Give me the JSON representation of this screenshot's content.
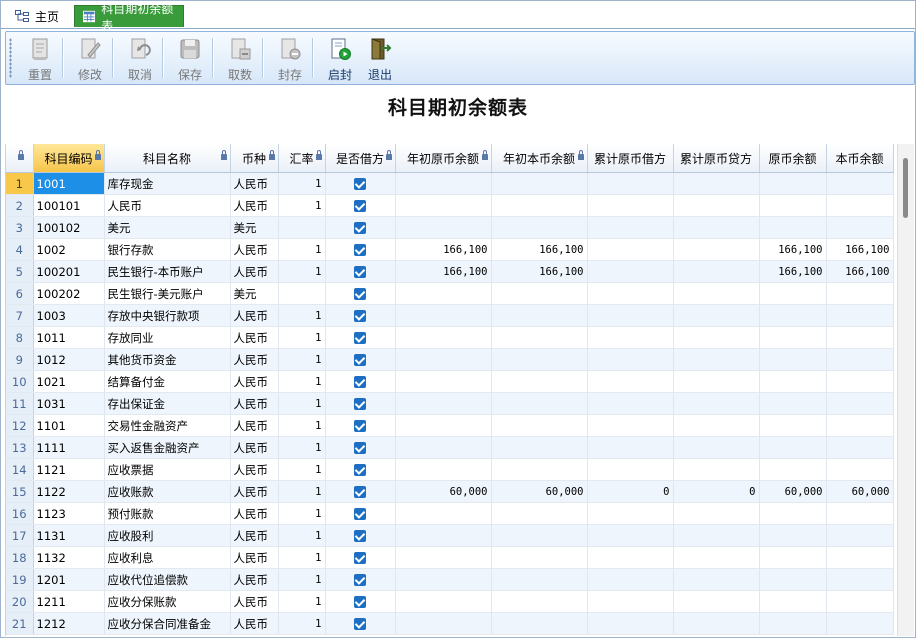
{
  "tabs": [
    {
      "label": "主页",
      "icon": "hierarchy-icon"
    },
    {
      "label": "科目期初余额表",
      "icon": "table-icon"
    }
  ],
  "toolbar": {
    "reset": "重置",
    "edit": "修改",
    "cancel": "取消",
    "save": "保存",
    "fetch": "取数",
    "seal": "封存",
    "unseal": "启封",
    "exit": "退出"
  },
  "title": "科目期初余额表",
  "columns": [
    "科目编码",
    "科目名称",
    "币种",
    "汇率",
    "是否借方",
    "年初原币余额",
    "年初本币余额",
    "累计原币借方",
    "累计原币贷方",
    "原币余额",
    "本币余额"
  ],
  "rows": [
    {
      "n": "1",
      "code": "1001",
      "name": "库存现金",
      "cur": "人民币",
      "rate": "1",
      "debit": true,
      "a": "",
      "b": "",
      "c": "",
      "d": "",
      "e": "",
      "f": ""
    },
    {
      "n": "2",
      "code": "100101",
      "name": "人民币",
      "cur": "人民币",
      "rate": "1",
      "debit": true,
      "a": "",
      "b": "",
      "c": "",
      "d": "",
      "e": "",
      "f": ""
    },
    {
      "n": "3",
      "code": "100102",
      "name": "美元",
      "cur": "美元",
      "rate": "",
      "debit": true,
      "a": "",
      "b": "",
      "c": "",
      "d": "",
      "e": "",
      "f": ""
    },
    {
      "n": "4",
      "code": "1002",
      "name": "银行存款",
      "cur": "人民币",
      "rate": "1",
      "debit": true,
      "a": "166,100",
      "b": "166,100",
      "c": "",
      "d": "",
      "e": "166,100",
      "f": "166,100"
    },
    {
      "n": "5",
      "code": "100201",
      "name": "民生银行-本币账户",
      "cur": "人民币",
      "rate": "1",
      "debit": true,
      "a": "166,100",
      "b": "166,100",
      "c": "",
      "d": "",
      "e": "166,100",
      "f": "166,100"
    },
    {
      "n": "6",
      "code": "100202",
      "name": "民生银行-美元账户",
      "cur": "美元",
      "rate": "",
      "debit": true,
      "a": "",
      "b": "",
      "c": "",
      "d": "",
      "e": "",
      "f": ""
    },
    {
      "n": "7",
      "code": "1003",
      "name": "存放中央银行款项",
      "cur": "人民币",
      "rate": "1",
      "debit": true,
      "a": "",
      "b": "",
      "c": "",
      "d": "",
      "e": "",
      "f": ""
    },
    {
      "n": "8",
      "code": "1011",
      "name": "存放同业",
      "cur": "人民币",
      "rate": "1",
      "debit": true,
      "a": "",
      "b": "",
      "c": "",
      "d": "",
      "e": "",
      "f": ""
    },
    {
      "n": "9",
      "code": "1012",
      "name": "其他货币资金",
      "cur": "人民币",
      "rate": "1",
      "debit": true,
      "a": "",
      "b": "",
      "c": "",
      "d": "",
      "e": "",
      "f": ""
    },
    {
      "n": "10",
      "code": "1021",
      "name": "结算备付金",
      "cur": "人民币",
      "rate": "1",
      "debit": true,
      "a": "",
      "b": "",
      "c": "",
      "d": "",
      "e": "",
      "f": ""
    },
    {
      "n": "11",
      "code": "1031",
      "name": "存出保证金",
      "cur": "人民币",
      "rate": "1",
      "debit": true,
      "a": "",
      "b": "",
      "c": "",
      "d": "",
      "e": "",
      "f": ""
    },
    {
      "n": "12",
      "code": "1101",
      "name": "交易性金融资产",
      "cur": "人民币",
      "rate": "1",
      "debit": true,
      "a": "",
      "b": "",
      "c": "",
      "d": "",
      "e": "",
      "f": ""
    },
    {
      "n": "13",
      "code": "1111",
      "name": "买入返售金融资产",
      "cur": "人民币",
      "rate": "1",
      "debit": true,
      "a": "",
      "b": "",
      "c": "",
      "d": "",
      "e": "",
      "f": ""
    },
    {
      "n": "14",
      "code": "1121",
      "name": "应收票据",
      "cur": "人民币",
      "rate": "1",
      "debit": true,
      "a": "",
      "b": "",
      "c": "",
      "d": "",
      "e": "",
      "f": ""
    },
    {
      "n": "15",
      "code": "1122",
      "name": "应收账款",
      "cur": "人民币",
      "rate": "1",
      "debit": true,
      "a": "60,000",
      "b": "60,000",
      "c": "0",
      "d": "0",
      "e": "60,000",
      "f": "60,000"
    },
    {
      "n": "16",
      "code": "1123",
      "name": "预付账款",
      "cur": "人民币",
      "rate": "1",
      "debit": true,
      "a": "",
      "b": "",
      "c": "",
      "d": "",
      "e": "",
      "f": ""
    },
    {
      "n": "17",
      "code": "1131",
      "name": "应收股利",
      "cur": "人民币",
      "rate": "1",
      "debit": true,
      "a": "",
      "b": "",
      "c": "",
      "d": "",
      "e": "",
      "f": ""
    },
    {
      "n": "18",
      "code": "1132",
      "name": "应收利息",
      "cur": "人民币",
      "rate": "1",
      "debit": true,
      "a": "",
      "b": "",
      "c": "",
      "d": "",
      "e": "",
      "f": ""
    },
    {
      "n": "19",
      "code": "1201",
      "name": "应收代位追偿款",
      "cur": "人民币",
      "rate": "1",
      "debit": true,
      "a": "",
      "b": "",
      "c": "",
      "d": "",
      "e": "",
      "f": ""
    },
    {
      "n": "20",
      "code": "1211",
      "name": "应收分保账款",
      "cur": "人民币",
      "rate": "1",
      "debit": true,
      "a": "",
      "b": "",
      "c": "",
      "d": "",
      "e": "",
      "f": ""
    },
    {
      "n": "21",
      "code": "1212",
      "name": "应收分保合同准备金",
      "cur": "人民币",
      "rate": "1",
      "debit": true,
      "a": "",
      "b": "",
      "c": "",
      "d": "",
      "e": "",
      "f": ""
    }
  ]
}
